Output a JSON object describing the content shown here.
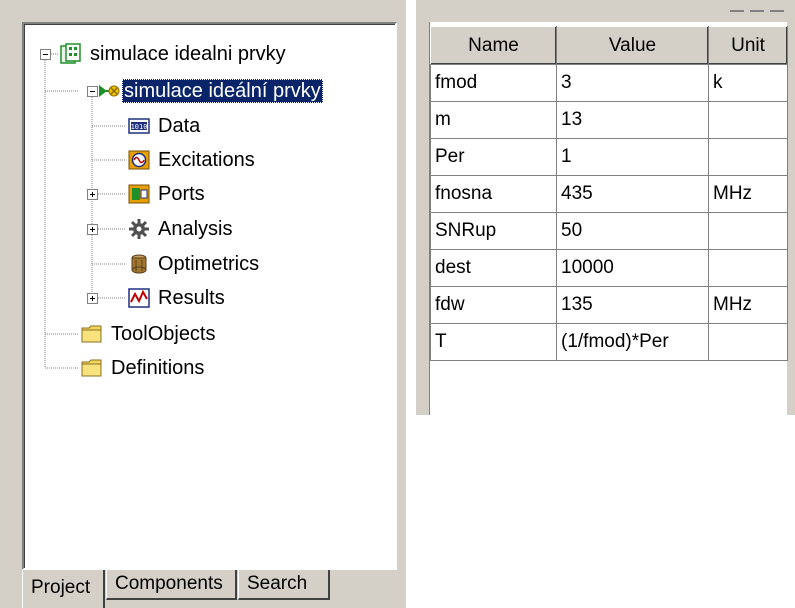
{
  "project_tree": {
    "root": {
      "label": "simulace idealni prvky",
      "icon": "project-icon"
    },
    "design": {
      "label": "simulace ideální prvky",
      "icon": "design-icon",
      "selected": true
    },
    "design_children": [
      {
        "label": "Data",
        "icon": "data-icon"
      },
      {
        "label": "Excitations",
        "icon": "excitations-icon"
      },
      {
        "label": "Ports",
        "icon": "ports-icon"
      },
      {
        "label": "Analysis",
        "icon": "gear-icon"
      },
      {
        "label": "Optimetrics",
        "icon": "optimetrics-icon"
      },
      {
        "label": "Results",
        "icon": "results-icon"
      }
    ],
    "tool_objects": {
      "label": "ToolObjects",
      "icon": "folder-icon"
    },
    "definitions": {
      "label": "Definitions",
      "icon": "folder-icon"
    }
  },
  "tabs": [
    {
      "label": "Project",
      "active": true
    },
    {
      "label": "Components",
      "active": false
    },
    {
      "label": "Search",
      "active": false
    }
  ],
  "properties": {
    "columns": [
      "Name",
      "Value",
      "Unit"
    ],
    "rows": [
      {
        "name": "fmod",
        "value": "3",
        "unit": "k"
      },
      {
        "name": "m",
        "value": "13",
        "unit": ""
      },
      {
        "name": "Per",
        "value": "1",
        "unit": ""
      },
      {
        "name": "fnosna",
        "value": "435",
        "unit": "MHz"
      },
      {
        "name": "SNRup",
        "value": "50",
        "unit": ""
      },
      {
        "name": "dest",
        "value": "10000",
        "unit": ""
      },
      {
        "name": "fdw",
        "value": "135",
        "unit": "MHz"
      },
      {
        "name": "T",
        "value": "(1/fmod)*Per",
        "unit": ""
      }
    ]
  },
  "colors": {
    "selection": "#0a246a",
    "panel": "#d4d0c8",
    "folder": "#f2d65f"
  }
}
